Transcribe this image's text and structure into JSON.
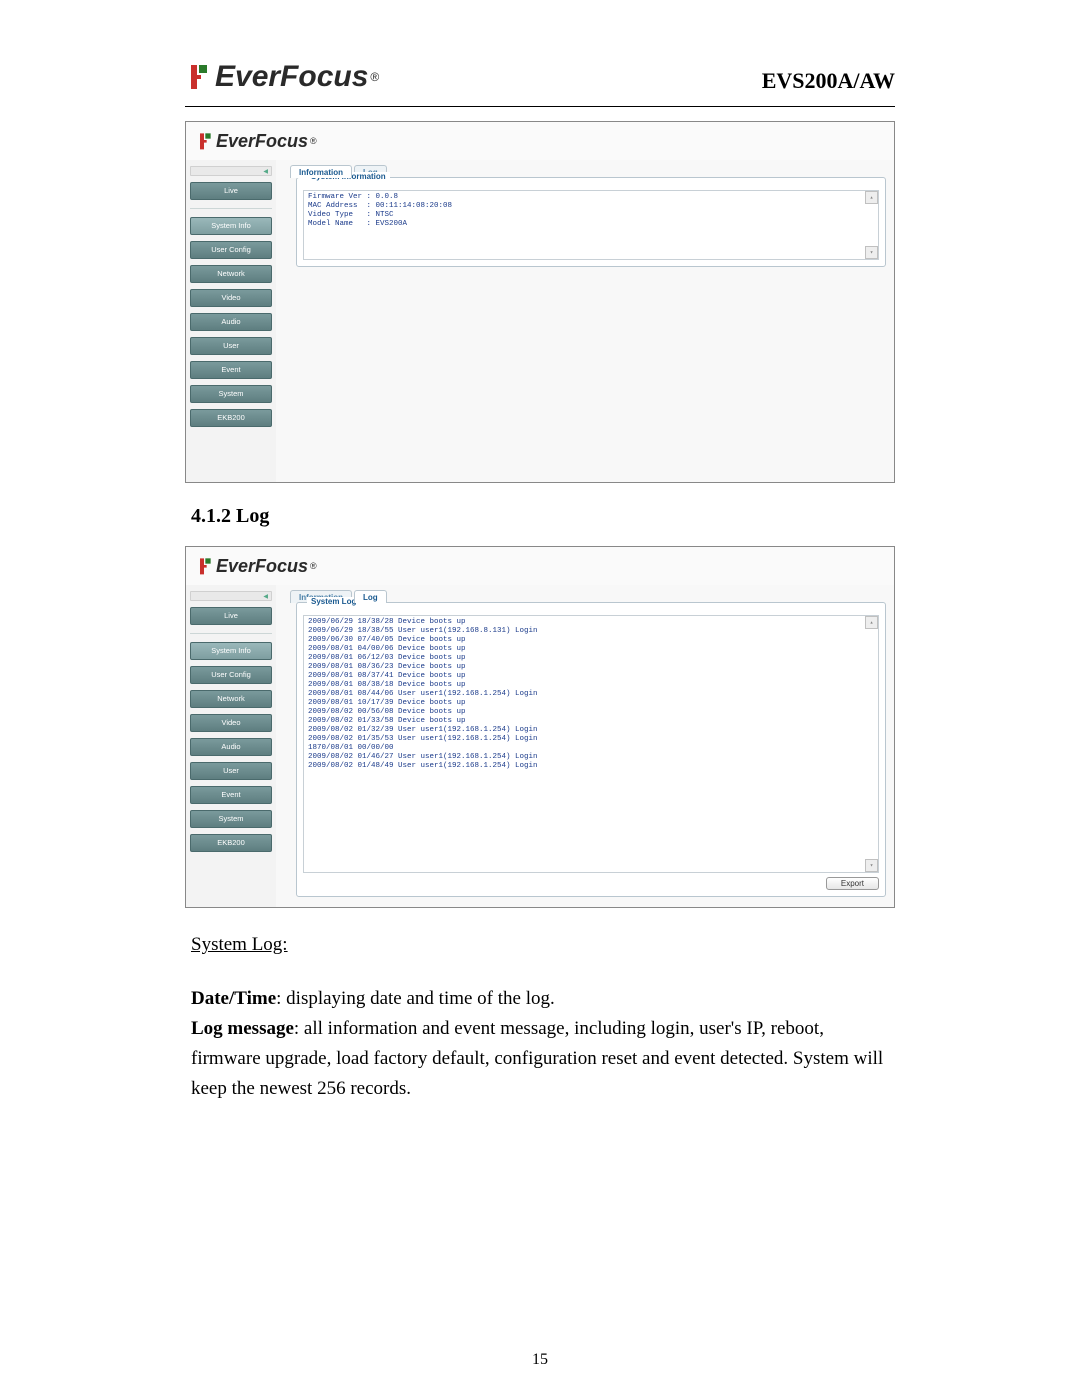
{
  "header": {
    "brand": "EverFocus",
    "model": "EVS200A/AW"
  },
  "section_heading": "4.1.2 Log",
  "sidebar": {
    "items": [
      {
        "label": "Live",
        "active": false
      },
      {
        "label": "System Info",
        "active": true
      },
      {
        "label": "User Config",
        "active": false
      },
      {
        "label": "Network",
        "active": false
      },
      {
        "label": "Video",
        "active": false
      },
      {
        "label": "Audio",
        "active": false
      },
      {
        "label": "User",
        "active": false
      },
      {
        "label": "Event",
        "active": false
      },
      {
        "label": "System",
        "active": false
      },
      {
        "label": "EKB200",
        "active": false
      }
    ]
  },
  "screenshot1": {
    "tabs": {
      "info": "Information",
      "log": "Log",
      "active": "info"
    },
    "legend": "System Information",
    "lines": "Firmware Ver : 0.0.8\nMAC Address  : 00:11:14:08:20:08\nVideo Type   : NTSC\nModel Name   : EVS200A"
  },
  "screenshot2": {
    "tabs": {
      "info": "Information",
      "log": "Log",
      "active": "log"
    },
    "legend": "System Log",
    "export": "Export",
    "lines": "2009/06/29 18/38/28 Device boots up\n2009/06/29 18/38/55 User user1(192.168.8.131) Login\n2009/06/30 07/40/05 Device boots up\n2009/08/01 04/00/06 Device boots up\n2009/08/01 06/12/03 Device boots up\n2009/08/01 08/36/23 Device boots up\n2009/08/01 08/37/41 Device boots up\n2009/08/01 08/38/18 Device boots up\n2009/08/01 08/44/06 User user1(192.168.1.254) Login\n2009/08/01 10/17/39 Device boots up\n2009/08/02 00/56/08 Device boots up\n2009/08/02 01/33/58 Device boots up\n2009/08/02 01/32/39 User user1(192.168.1.254) Login\n2009/08/02 01/35/53 User user1(192.168.1.254) Login\n1870/08/01 00/00/00\n2009/08/02 01/46/27 User user1(192.168.1.254) Login\n2009/08/02 01/48/49 User user1(192.168.1.254) Login"
  },
  "body": {
    "system_log_label": "System Log:",
    "date_time_label": "Date/Time",
    "date_time_text": ": displaying date and time of the log.",
    "log_msg_label": "Log message",
    "log_msg_text": ": all information and event message, including login, user's IP, reboot, firmware upgrade, load factory default, configuration reset and event detected. System will keep the newest 256 records."
  },
  "page_number": "15"
}
